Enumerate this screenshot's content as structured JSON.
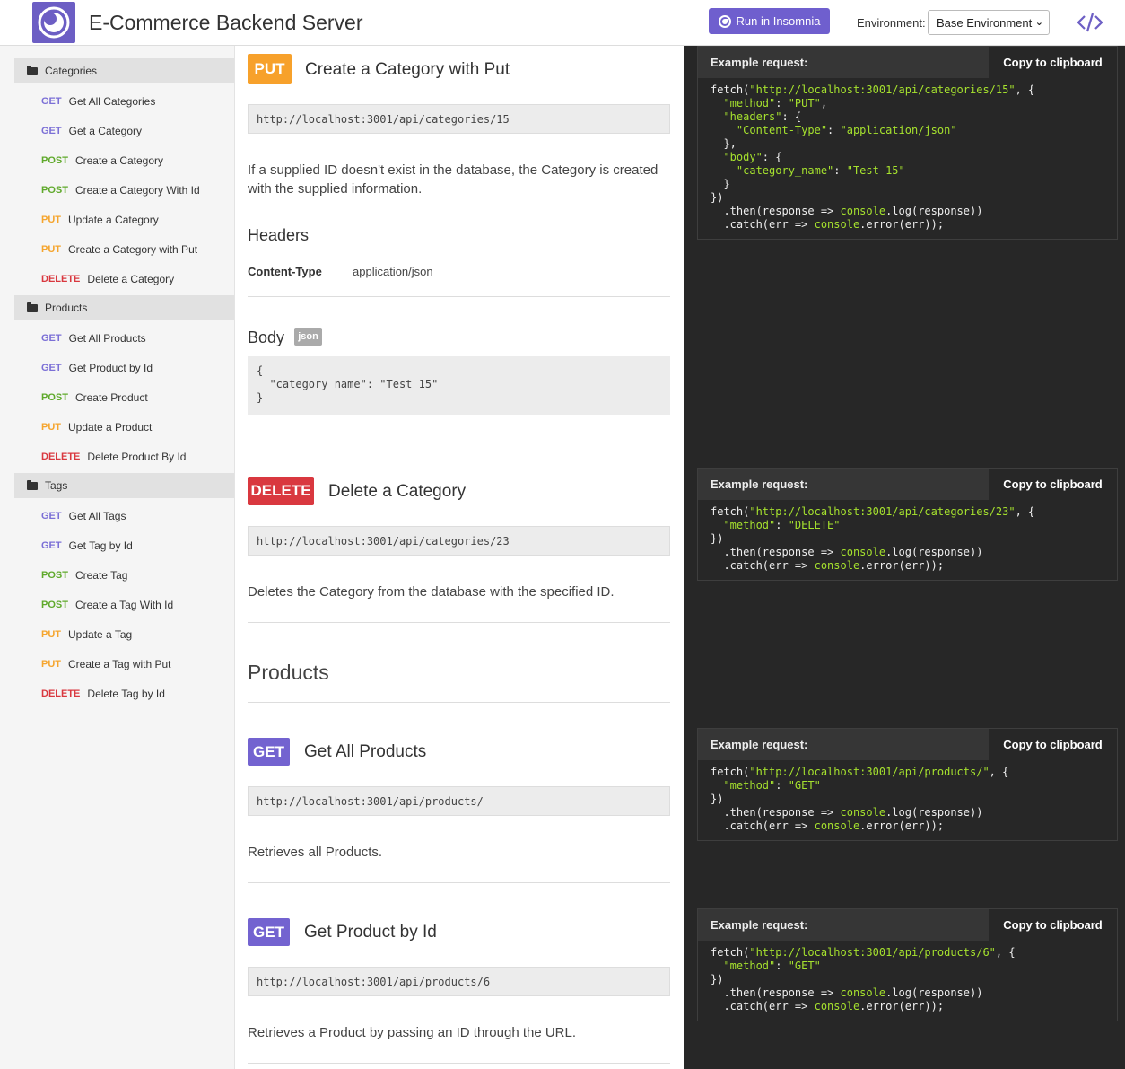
{
  "app": {
    "title": "E-Commerce Backend Server"
  },
  "header": {
    "run_label": "Run in Insomnia",
    "env_label": "Environment:",
    "env_value": "Base Environment"
  },
  "sidebar": {
    "groups": [
      {
        "label": "Categories",
        "items": [
          {
            "method": "GET",
            "label": "Get All Categories"
          },
          {
            "method": "GET",
            "label": "Get a Category"
          },
          {
            "method": "POST",
            "label": "Create a Category"
          },
          {
            "method": "POST",
            "label": "Create a Category With Id"
          },
          {
            "method": "PUT",
            "label": "Update a Category"
          },
          {
            "method": "PUT",
            "label": "Create a Category with Put"
          },
          {
            "method": "DELETE",
            "label": "Delete a Category"
          }
        ]
      },
      {
        "label": "Products",
        "items": [
          {
            "method": "GET",
            "label": "Get All Products"
          },
          {
            "method": "GET",
            "label": "Get Product by Id"
          },
          {
            "method": "POST",
            "label": "Create Product"
          },
          {
            "method": "PUT",
            "label": "Update a Product"
          },
          {
            "method": "DELETE",
            "label": "Delete Product By Id"
          }
        ]
      },
      {
        "label": "Tags",
        "items": [
          {
            "method": "GET",
            "label": "Get All Tags"
          },
          {
            "method": "GET",
            "label": "Get Tag by Id"
          },
          {
            "method": "POST",
            "label": "Create Tag"
          },
          {
            "method": "POST",
            "label": "Create a Tag With Id"
          },
          {
            "method": "PUT",
            "label": "Update a Tag"
          },
          {
            "method": "PUT",
            "label": "Create a Tag with Put"
          },
          {
            "method": "DELETE",
            "label": "Delete Tag by Id"
          }
        ]
      }
    ]
  },
  "main": {
    "ep1": {
      "method": "PUT",
      "title": "Create a Category with Put",
      "url": "http://localhost:3001/api/categories/15",
      "desc": "If a supplied ID doesn't exist in the database, the Category is created with the supplied information.",
      "headers_h": "Headers",
      "header_key": "Content-Type",
      "header_val": "application/json",
      "body_h": "Body",
      "body_tag": "json",
      "body": "{\n  \"category_name\": \"Test 15\"\n}"
    },
    "ep2": {
      "method": "DELETE",
      "title": "Delete a Category",
      "url": "http://localhost:3001/api/categories/23",
      "desc": "Deletes the Category from the database with the specified ID."
    },
    "section_products": "Products",
    "ep3": {
      "method": "GET",
      "title": "Get All Products",
      "url": "http://localhost:3001/api/products/",
      "desc": "Retrieves all Products."
    },
    "ep4": {
      "method": "GET",
      "title": "Get Product by Id",
      "url": "http://localhost:3001/api/products/6",
      "desc": "Retrieves a Product by passing an ID through the URL."
    }
  },
  "examples": {
    "label": "Example request:",
    "copy_label": "Copy to clipboard",
    "code1": {
      "l1a": "fetch(",
      "l1s": "\"http://localhost:3001/api/categories/15\"",
      "l1b": ", {",
      "l2k": "  \"method\"",
      "l2c": ": ",
      "l2v": "\"PUT\"",
      "l2e": ",",
      "l3k": "  \"headers\"",
      "l3c": ": {",
      "l4k": "    \"Content-Type\"",
      "l4c": ": ",
      "l4v": "\"application/json\"",
      "l5": "  },",
      "l6k": "  \"body\"",
      "l6c": ": {",
      "l7k": "    \"category_name\"",
      "l7c": ": ",
      "l7v": "\"Test 15\"",
      "l8": "  }",
      "l9": "})",
      "l10a": "  .then(response => ",
      "l10s": "console",
      "l10b": ".log(response))",
      "l11a": "  .catch(err => ",
      "l11s": "console",
      "l11b": ".error(err));"
    },
    "code2": {
      "l1a": "fetch(",
      "l1s": "\"http://localhost:3001/api/categories/23\"",
      "l1b": ", {",
      "l2k": "  \"method\"",
      "l2c": ": ",
      "l2v": "\"DELETE\"",
      "l3": "})",
      "l4a": "  .then(response => ",
      "l4s": "console",
      "l4b": ".log(response))",
      "l5a": "  .catch(err => ",
      "l5s": "console",
      "l5b": ".error(err));"
    },
    "code3": {
      "l1a": "fetch(",
      "l1s": "\"http://localhost:3001/api/products/\"",
      "l1b": ", {",
      "l2k": "  \"method\"",
      "l2c": ": ",
      "l2v": "\"GET\"",
      "l3": "})",
      "l4a": "  .then(response => ",
      "l4s": "console",
      "l4b": ".log(response))",
      "l5a": "  .catch(err => ",
      "l5s": "console",
      "l5b": ".error(err));"
    },
    "code4": {
      "l1a": "fetch(",
      "l1s": "\"http://localhost:3001/api/products/6\"",
      "l1b": ", {",
      "l2k": "  \"method\"",
      "l2c": ": ",
      "l2v": "\"GET\"",
      "l3": "})",
      "l4a": "  .then(response => ",
      "l4s": "console",
      "l4b": ".log(response))",
      "l5a": "  .catch(err => ",
      "l5s": "console",
      "l5b": ".error(err));"
    }
  },
  "colors": {
    "brand": "#6c5ec4",
    "get": "#7363d0",
    "post": "#5fa92b",
    "put": "#f7a12b",
    "delete": "#d9383f",
    "code_string": "#a6e22e"
  },
  "icons": [
    "insomnia-logo-icon",
    "run-icon",
    "chevron-down-icon",
    "code-icon",
    "folder-icon"
  ]
}
